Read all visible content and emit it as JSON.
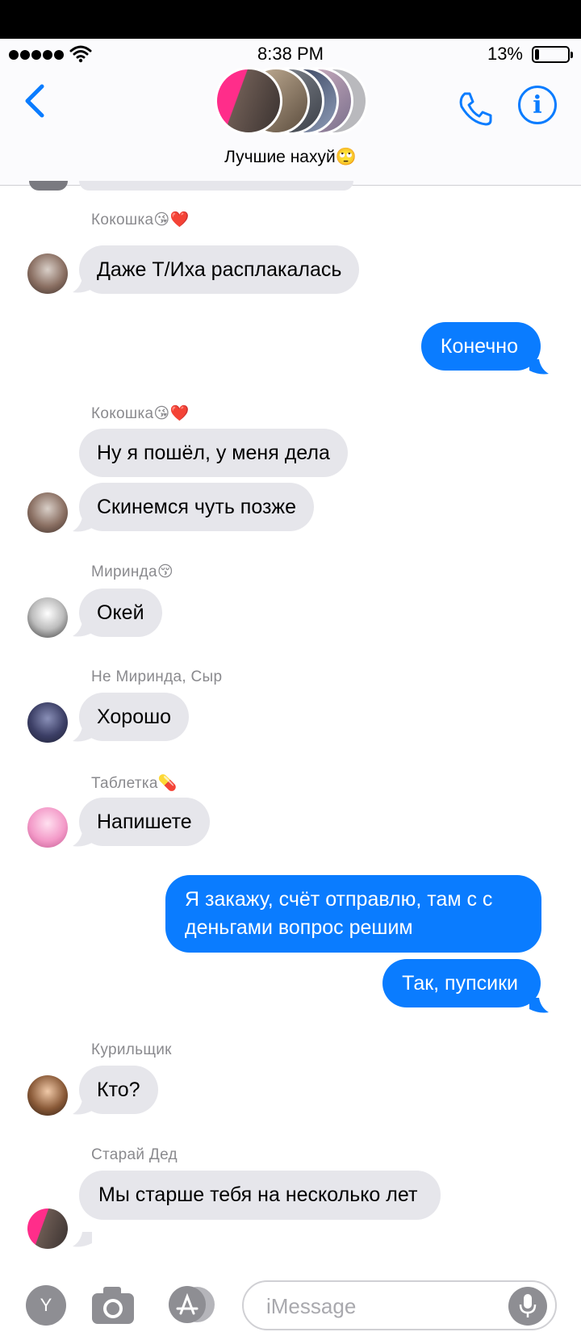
{
  "status": {
    "time": "8:38 PM",
    "battery_pct": "13%",
    "battery_level": 0.13
  },
  "header": {
    "group_name": "Лучшие нахуй🙄",
    "back_icon": "chevron-left-icon",
    "call_icon": "phone-icon",
    "info_icon": "info-icon",
    "info_glyph": "i"
  },
  "messages": [
    {
      "id": "m1",
      "type": "in",
      "sender": "Кокошка😘❤️",
      "text": "Даже Т/Иха расплакалась"
    },
    {
      "id": "m2",
      "type": "out",
      "text": "Конечно"
    },
    {
      "id": "m3",
      "type": "in",
      "sender": "Кокошка😘❤️",
      "text": "Ну я пошёл, у меня дела"
    },
    {
      "id": "m4",
      "type": "in",
      "text": "Скинемся чуть позже"
    },
    {
      "id": "m5",
      "type": "in",
      "sender": "Миринда😚",
      "text": "Окей"
    },
    {
      "id": "m6",
      "type": "in",
      "sender": "Не Миринда, Сыр",
      "text": "Хорошо"
    },
    {
      "id": "m7",
      "type": "in",
      "sender": "Таблетка💊",
      "text": "Напишете"
    },
    {
      "id": "m8",
      "type": "out",
      "text": "Я закажу, счёт отправлю, там с с деньгами вопрос решим"
    },
    {
      "id": "m9",
      "type": "out",
      "text": "Так, пупсики"
    },
    {
      "id": "m10",
      "type": "in",
      "sender": "Курильщик",
      "text": "Кто?"
    },
    {
      "id": "m11",
      "type": "in",
      "sender": "Старай Дед",
      "text": "Мы старше тебя на несколько лет"
    }
  ],
  "input": {
    "placeholder": "iMessage",
    "apps_label": "Y"
  },
  "colors": {
    "accent": "#0a7cff",
    "incoming_bubble": "#e6e6eb",
    "outgoing_bubble": "#0a7cff"
  }
}
